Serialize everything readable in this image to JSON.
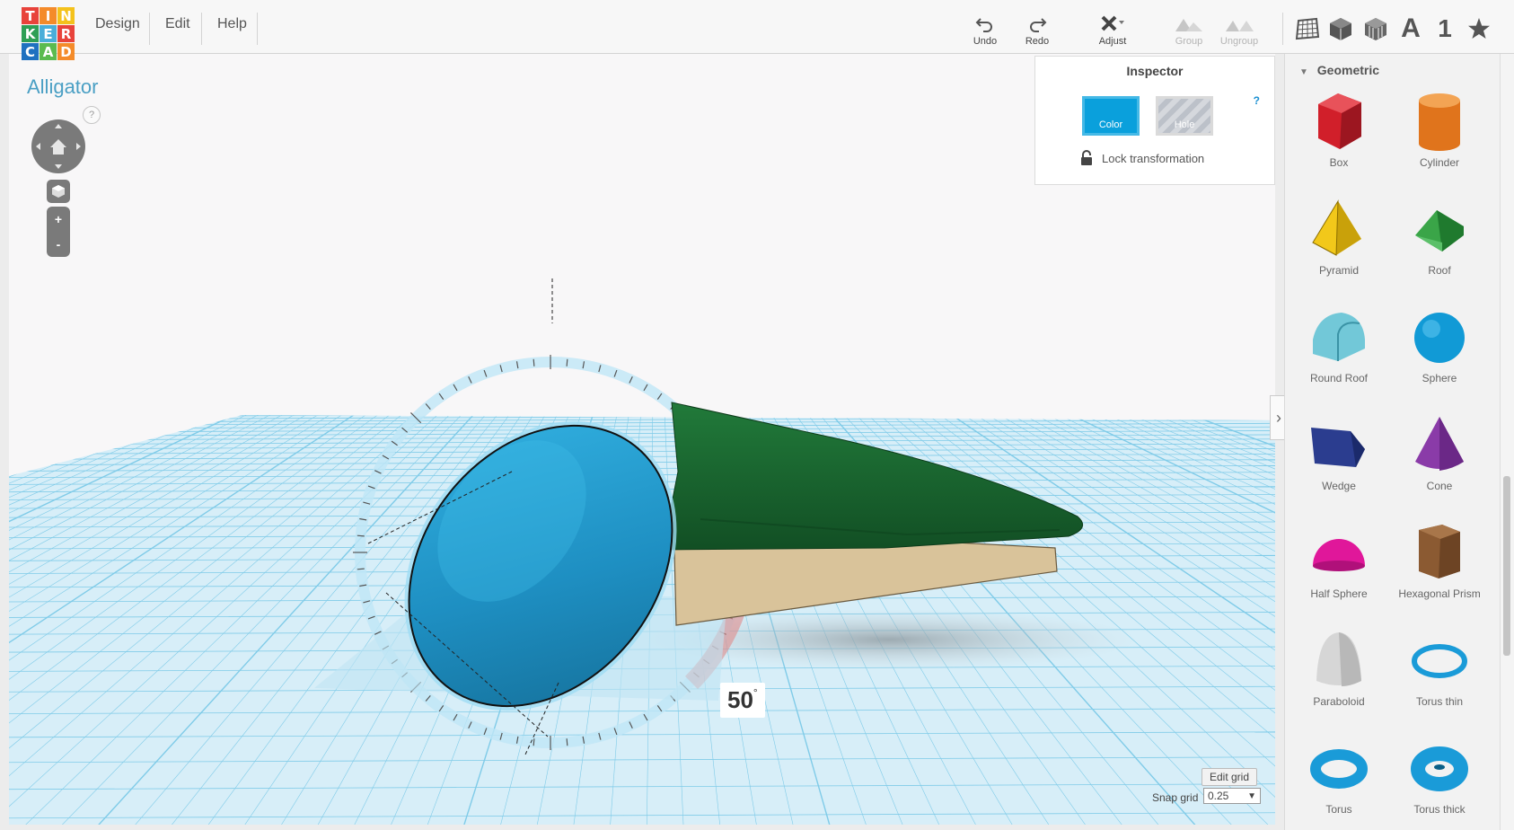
{
  "logo": {
    "letters": [
      "T",
      "I",
      "N",
      "K",
      "E",
      "R",
      "C",
      "A",
      "D"
    ],
    "colors": [
      "#e8433b",
      "#f48b2a",
      "#f4c21c",
      "#2e9f56",
      "#4aaed9",
      "#e8433b",
      "#1f71c0",
      "#5bbb50",
      "#f48b2a"
    ]
  },
  "menu": {
    "design": "Design",
    "edit": "Edit",
    "help": "Help"
  },
  "toolbar": {
    "undo": "Undo",
    "redo": "Redo",
    "adjust": "Adjust",
    "group": "Group",
    "ungroup": "Ungroup"
  },
  "view_buttons": {
    "text_label": "A",
    "number_label": "1"
  },
  "design_title": "Alligator",
  "navigation": {
    "help": "?",
    "zoom_in": "+",
    "zoom_out": "-"
  },
  "inspector": {
    "title": "Inspector",
    "color_label": "Color",
    "hole_label": "Hole",
    "help": "?",
    "lock_label": "Lock transformation"
  },
  "rotation_readout": {
    "value": "50",
    "unit": "°"
  },
  "grid": {
    "edit_label": "Edit grid",
    "snap_label": "Snap grid",
    "snap_value": "0.25"
  },
  "shapes": {
    "category": "Geometric",
    "items": [
      {
        "name": "Box",
        "color": "#d11f2a"
      },
      {
        "name": "Cylinder",
        "color": "#e0741c"
      },
      {
        "name": "Pyramid",
        "color": "#f2c81a"
      },
      {
        "name": "Roof",
        "color": "#3aa548"
      },
      {
        "name": "Round Roof",
        "color": "#72c8d8"
      },
      {
        "name": "Sphere",
        "color": "#119ad6"
      },
      {
        "name": "Wedge",
        "color": "#2b3d8f"
      },
      {
        "name": "Cone",
        "color": "#8a3ba8"
      },
      {
        "name": "Half Sphere",
        "color": "#e0179a"
      },
      {
        "name": "Hexagonal Prism",
        "color": "#8b5a32"
      },
      {
        "name": "Paraboloid",
        "color": "#d6d6d6"
      },
      {
        "name": "Torus thin",
        "color": "#1a9bd8"
      },
      {
        "name": "Torus",
        "color": "#1a9bd8"
      },
      {
        "name": "Torus thick",
        "color": "#1a9bd8"
      }
    ]
  },
  "scene_colors": {
    "ellipsoid": "#2ba3d4",
    "green_part": "#1b6b32",
    "tan_part": "#d9c39a",
    "grid": "#7fcbe8"
  }
}
